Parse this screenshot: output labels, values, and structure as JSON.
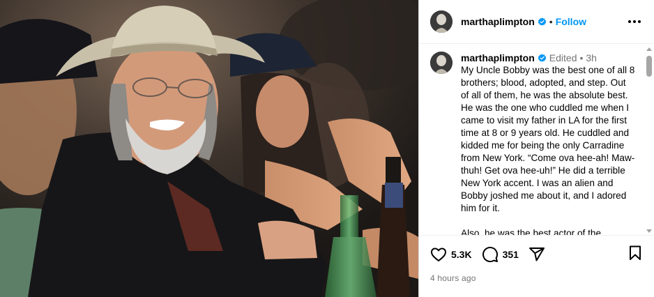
{
  "post": {
    "author": "marthaplimpton",
    "follow_label": "Follow",
    "header_separator": "•",
    "photo_alt": "Man in a cowboy hat and glasses smiling at a bar"
  },
  "caption": {
    "author": "marthaplimpton",
    "edited_label": "Edited",
    "separator": "•",
    "age": "3h",
    "text": "My Uncle Bobby was the best one of all 8 brothers; blood, adopted, and step. Out of all of them, he was the absolute best. He was the one who cuddled me when I came to visit my father in LA for the first time at 8 or 9 years old. He cuddled and kidded me for being the only Carradine from New York. “Come ova hee-ah! Maw-thuh! Get ova hee-uh!” He did a terrible New York accent. I was an alien and Bobby joshed me about it, and I adored him for it.\n\nAlso, he was the best actor of the"
  },
  "engagement": {
    "likes": "5.3K",
    "comments": "351",
    "timestamp": "4 hours ago"
  },
  "colors": {
    "accent": "#0095f6",
    "muted": "#737373",
    "divider": "#efefef"
  },
  "icons": [
    "verified-icon",
    "more-icon",
    "heart-icon",
    "comment-icon",
    "share-icon",
    "bookmark-icon"
  ]
}
